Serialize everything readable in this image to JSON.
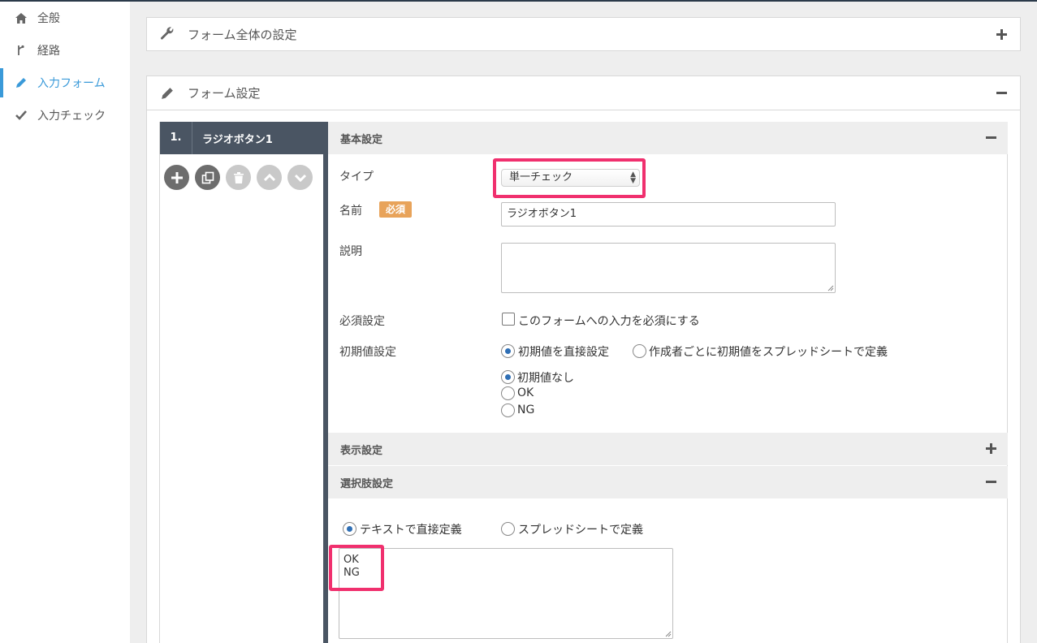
{
  "sidebar": {
    "items": [
      {
        "label": "全般",
        "icon": "home-icon"
      },
      {
        "label": "経路",
        "icon": "branch-icon"
      },
      {
        "label": "入力フォーム",
        "icon": "pencil-icon",
        "active": true
      },
      {
        "label": "入力チェック",
        "icon": "check-icon"
      }
    ]
  },
  "form_overall": {
    "title": "フォーム全体の設定",
    "expanded": false
  },
  "form_settings": {
    "title": "フォーム設定",
    "expanded": true
  },
  "item": {
    "number": "1.",
    "label": "ラジオボタン1"
  },
  "basic": {
    "title": "基本設定",
    "type_label": "タイプ",
    "type_value": "単一チェック",
    "name_label": "名前",
    "required_badge": "必須",
    "name_value": "ラジオボタン1",
    "desc_label": "説明",
    "desc_value": "",
    "required_label": "必須設定",
    "required_checkbox": "このフォームへの入力を必須にする",
    "initial_label": "初期値設定",
    "initial_direct": "初期値を直接設定",
    "initial_sheet": "作成者ごとに初期値をスプレッドシートで定義",
    "initial_options": [
      "初期値なし",
      "OK",
      "NG"
    ]
  },
  "display": {
    "title": "表示設定",
    "expanded": false
  },
  "choices": {
    "title": "選択肢設定",
    "direct": "テキストで直接定義",
    "sheet": "スプレッドシートで定義",
    "text_lines": [
      "OK",
      "NG"
    ]
  },
  "colors": {
    "accent": "#3a9ad9",
    "highlight": "#f0306e",
    "badge": "#e8a35a",
    "dark": "#4a5563"
  }
}
